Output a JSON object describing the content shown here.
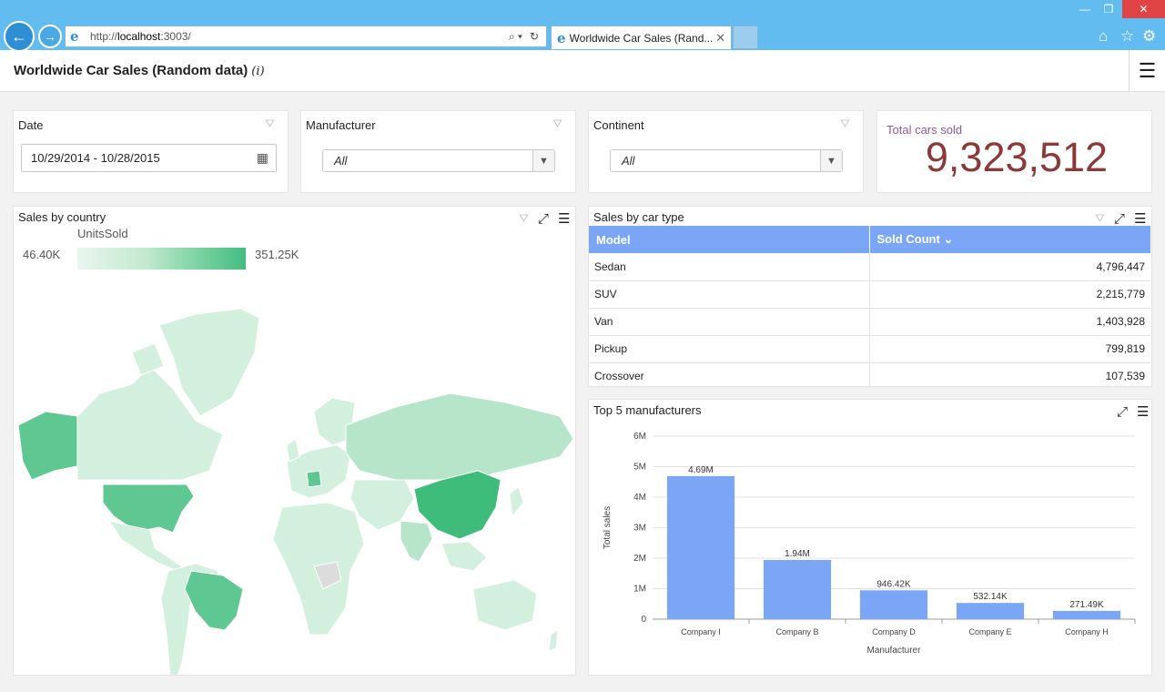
{
  "browser": {
    "url_prefix": "http://",
    "url_host": "localhost",
    "url_rest": ":3003/",
    "tab_title": "Worldwide Car Sales (Rand...",
    "tab_close": "✕"
  },
  "app": {
    "title": "Worldwide Car Sales (Random data)",
    "info_icon": "(i)"
  },
  "filters": {
    "date": {
      "label": "Date",
      "value": "10/29/2014 - 10/28/2015"
    },
    "manufacturer": {
      "label": "Manufacturer",
      "value": "All"
    },
    "continent": {
      "label": "Continent",
      "value": "All"
    }
  },
  "kpi": {
    "label": "Total cars sold",
    "value": "9,323,512"
  },
  "map": {
    "title": "Sales by country",
    "legend_title": "UnitsSold",
    "legend_min": "46.40K",
    "legend_max": "351.25K",
    "colors": {
      "low": "#d3f0de",
      "mid": "#b6e5c9",
      "high": "#5fc892",
      "top": "#3fbb7a",
      "nodata": "#dcdcdc"
    }
  },
  "cartype": {
    "title": "Sales by car type",
    "columns": [
      "Model",
      "Sold Count"
    ],
    "rows": [
      {
        "model": "Sedan",
        "count": "4,796,447"
      },
      {
        "model": "SUV",
        "count": "2,215,779"
      },
      {
        "model": "Van",
        "count": "1,403,928"
      },
      {
        "model": "Pickup",
        "count": "799,819"
      },
      {
        "model": "Crossover",
        "count": "107,539"
      }
    ]
  },
  "top5": {
    "title": "Top 5 manufacturers"
  },
  "chart_data": {
    "type": "bar",
    "title": "",
    "xlabel": "Manufacturer",
    "ylabel": "Total sales",
    "categories": [
      "Company I",
      "Company B",
      "Company D",
      "Company E",
      "Company H"
    ],
    "values": [
      4690000,
      1940000,
      946420,
      532140,
      271490
    ],
    "data_labels": [
      "4.69M",
      "1.94M",
      "946.42K",
      "532.14K",
      "271.49K"
    ],
    "yticks": [
      "0",
      "1M",
      "2M",
      "3M",
      "4M",
      "5M",
      "6M"
    ],
    "ylim": [
      0,
      6000000
    ],
    "grid": true,
    "bar_color": "#7aa6f5"
  }
}
